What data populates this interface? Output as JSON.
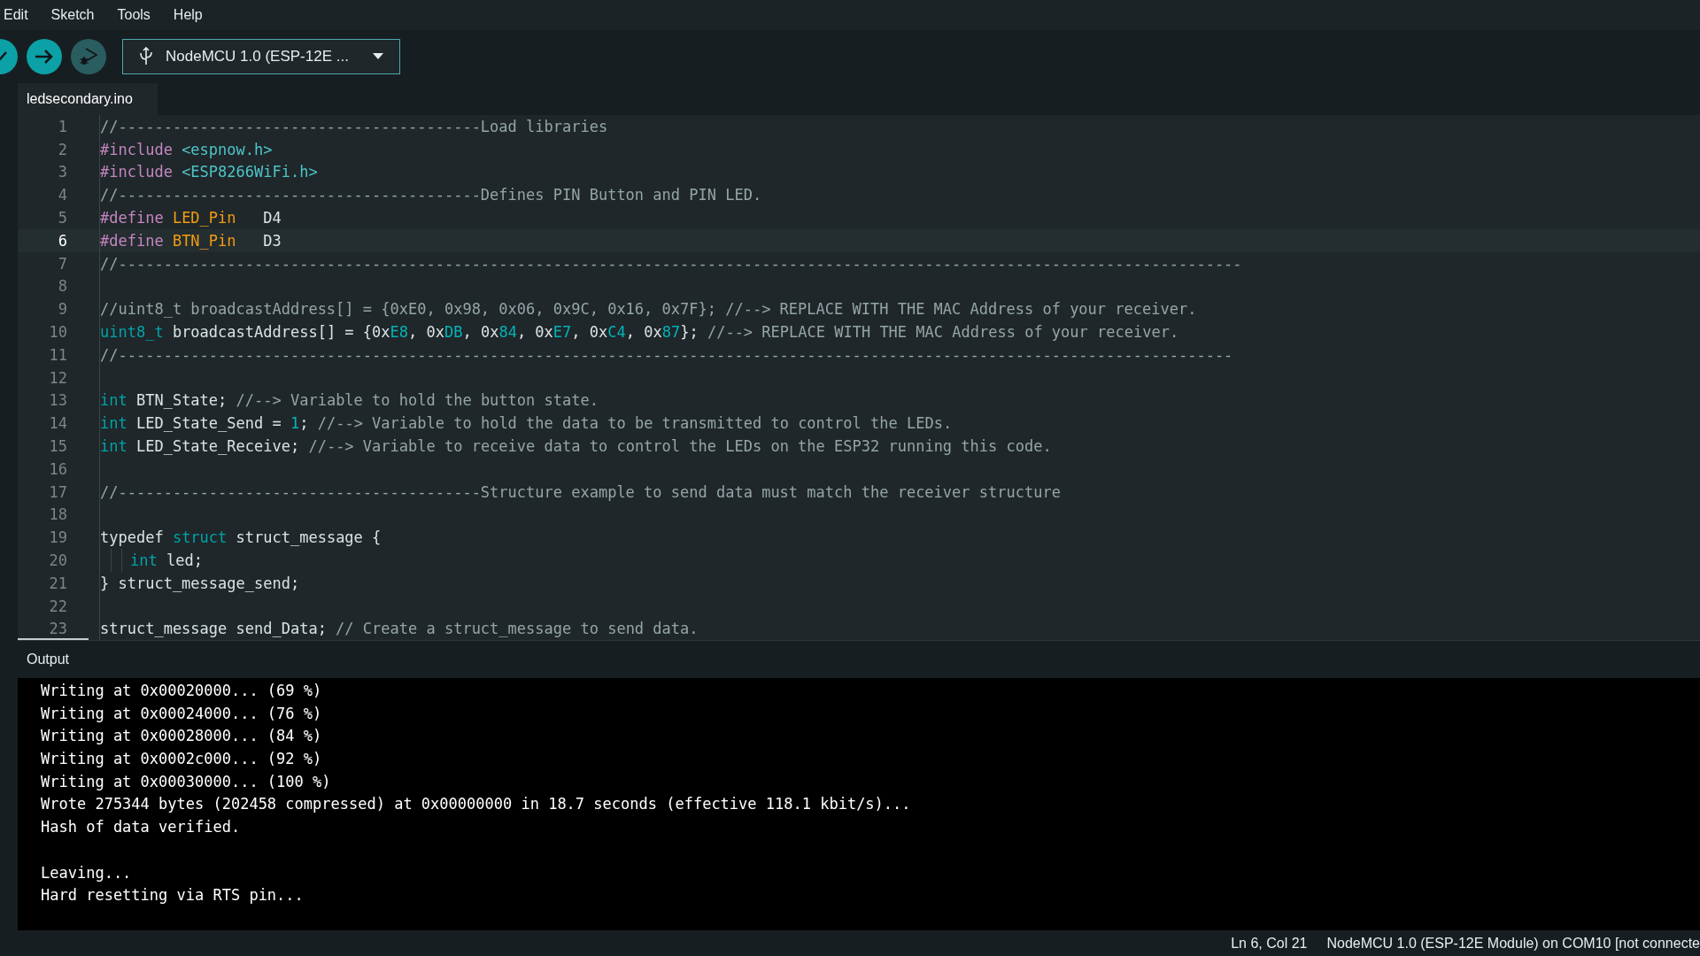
{
  "menu": [
    "Edit",
    "Sketch",
    "Tools",
    "Help"
  ],
  "toolbar": {
    "buttons": [
      {
        "kind": "verify",
        "disabled": false
      },
      {
        "kind": "upload",
        "disabled": false
      },
      {
        "kind": "debug",
        "disabled": true
      }
    ],
    "board": "NodeMCU 1.0 (ESP-12E ..."
  },
  "tabs": [
    {
      "label": "ledsecondary.ino",
      "selected": true
    }
  ],
  "editor": {
    "lines": [
      {
        "number": "1",
        "current": false,
        "tokens": [
          {
            "kind": "comment",
            "text": "//----------------------------------------Load libraries"
          }
        ]
      },
      {
        "number": "2",
        "current": false,
        "tokens": [
          {
            "kind": "directive",
            "text": "#include "
          },
          {
            "kind": "path",
            "text": "<espnow.h>"
          }
        ]
      },
      {
        "number": "3",
        "current": false,
        "tokens": [
          {
            "kind": "directive",
            "text": "#include "
          },
          {
            "kind": "path",
            "text": "<ESP8266WiFi.h>"
          }
        ]
      },
      {
        "number": "4",
        "current": false,
        "tokens": [
          {
            "kind": "comment",
            "text": "//----------------------------------------Defines PIN Button and PIN LED."
          }
        ]
      },
      {
        "number": "5",
        "current": false,
        "tokens": [
          {
            "kind": "directive",
            "text": "#define "
          },
          {
            "kind": "macro",
            "text": "LED_Pin"
          },
          {
            "kind": "plain",
            "text": "   D4"
          }
        ]
      },
      {
        "number": "6",
        "current": true,
        "tokens": [
          {
            "kind": "directive",
            "text": "#define "
          },
          {
            "kind": "macro",
            "text": "BTN_Pin"
          },
          {
            "kind": "plain",
            "text": "   D3"
          }
        ]
      },
      {
        "number": "7",
        "current": false,
        "tokens": [
          {
            "kind": "comment",
            "text": "//----------------------------------------------------------------------------------------------------------------------------"
          }
        ]
      },
      {
        "number": "8",
        "current": false
      },
      {
        "number": "9",
        "current": false,
        "tokens": [
          {
            "kind": "comment",
            "text": "//uint8_t broadcastAddress[] = {0xE0, 0x98, 0x06, 0x9C, 0x16, 0x7F}; //--> REPLACE WITH THE MAC Address of your receiver."
          }
        ]
      },
      {
        "number": "10",
        "current": false,
        "tokens": [
          {
            "kind": "type",
            "text": "uint8_t"
          },
          {
            "kind": "plain",
            "text": " broadcastAddress[] = {0x"
          },
          {
            "kind": "number",
            "text": "E8"
          },
          {
            "kind": "plain",
            "text": ", 0x"
          },
          {
            "kind": "number",
            "text": "DB"
          },
          {
            "kind": "plain",
            "text": ", 0x"
          },
          {
            "kind": "number",
            "text": "84"
          },
          {
            "kind": "plain",
            "text": ", 0x"
          },
          {
            "kind": "number",
            "text": "E7"
          },
          {
            "kind": "plain",
            "text": ", 0x"
          },
          {
            "kind": "number",
            "text": "C4"
          },
          {
            "kind": "plain",
            "text": ", 0x"
          },
          {
            "kind": "number",
            "text": "87"
          },
          {
            "kind": "plain",
            "text": "}; "
          },
          {
            "kind": "comment",
            "text": "//--> REPLACE WITH THE MAC Address of your receiver."
          }
        ]
      },
      {
        "number": "11",
        "current": false,
        "tokens": [
          {
            "kind": "comment",
            "text": "//---------------------------------------------------------------------------------------------------------------------------"
          }
        ]
      },
      {
        "number": "12",
        "current": false
      },
      {
        "number": "13",
        "current": false,
        "tokens": [
          {
            "kind": "type",
            "text": "int"
          },
          {
            "kind": "plain",
            "text": " BTN_State; "
          },
          {
            "kind": "comment",
            "text": "//--> Variable to hold the button state."
          }
        ]
      },
      {
        "number": "14",
        "current": false,
        "tokens": [
          {
            "kind": "type",
            "text": "int"
          },
          {
            "kind": "plain",
            "text": " LED_State_Send = "
          },
          {
            "kind": "number",
            "text": "1"
          },
          {
            "kind": "plain",
            "text": "; "
          },
          {
            "kind": "comment",
            "text": "//--> Variable to hold the data to be transmitted to control the LEDs."
          }
        ]
      },
      {
        "number": "15",
        "current": false,
        "tokens": [
          {
            "kind": "type",
            "text": "int"
          },
          {
            "kind": "plain",
            "text": " LED_State_Receive; "
          },
          {
            "kind": "comment",
            "text": "//--> Variable to receive data to control the LEDs on the ESP32 running this code."
          }
        ]
      },
      {
        "number": "16",
        "current": false
      },
      {
        "number": "17",
        "current": false,
        "tokens": [
          {
            "kind": "comment",
            "text": "//----------------------------------------Structure example to send data must match the receiver structure"
          }
        ]
      },
      {
        "number": "18",
        "current": false
      },
      {
        "number": "19",
        "current": false,
        "tokens": [
          {
            "kind": "plain",
            "text": "typedef "
          },
          {
            "kind": "type",
            "text": "struct"
          },
          {
            "kind": "plain",
            "text": " struct_message {"
          }
        ]
      },
      {
        "number": "20",
        "current": false,
        "indented": true,
        "tokens": [
          {
            "kind": "type",
            "text": "int"
          },
          {
            "kind": "plain",
            "text": " led;"
          }
        ]
      },
      {
        "number": "21",
        "current": false,
        "tokens": [
          {
            "kind": "plain",
            "text": "} struct_message_send;"
          }
        ]
      },
      {
        "number": "22",
        "current": false
      },
      {
        "number": "23",
        "current": false,
        "tokens": [
          {
            "kind": "plain",
            "text": "struct_message send_Data; "
          },
          {
            "kind": "comment",
            "text": "// Create a struct_message to send data."
          }
        ]
      }
    ]
  },
  "output": {
    "title": "Output",
    "lines": [
      {
        "text": "Writing at 0x00020000... (69 %)",
        "blank_before": false
      },
      {
        "text": "Writing at 0x00024000... (76 %)",
        "blank_before": false
      },
      {
        "text": "Writing at 0x00028000... (84 %)",
        "blank_before": false
      },
      {
        "text": "Writing at 0x0002c000... (92 %)",
        "blank_before": false
      },
      {
        "text": "Writing at 0x00030000... (100 %)",
        "blank_before": false
      },
      {
        "text": "Wrote 275344 bytes (202458 compressed) at 0x00000000 in 18.7 seconds (effective 118.1 kbit/s)...",
        "blank_before": false
      },
      {
        "text": "Hash of data verified.",
        "blank_before": false
      },
      {
        "text": "Leaving...",
        "blank_before": true
      },
      {
        "text": "Hard resetting via RTS pin...",
        "blank_before": false
      }
    ]
  },
  "status_bar": {
    "position": "Ln 6, Col 21",
    "board": "NodeMCU 1.0 (ESP-12E Module) on COM10 [not connecte"
  }
}
